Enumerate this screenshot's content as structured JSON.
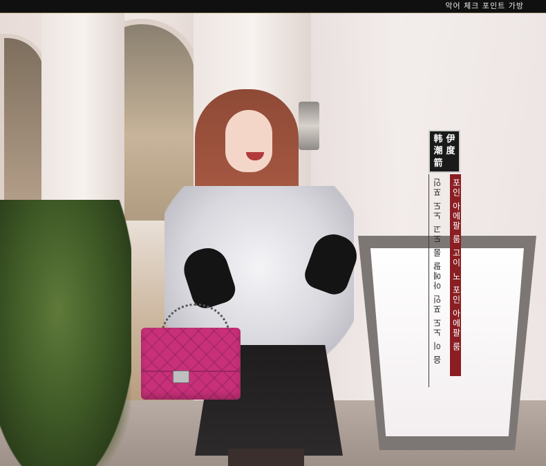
{
  "header": {
    "title": "악어 체크 포인트 가방"
  },
  "overlay": {
    "logo": {
      "chars": [
        "伊",
        "韩",
        "度",
        "潮",
        "箭"
      ]
    },
    "vertical_text_dark": "음 이 노도 포인 아에팔 룸 도고 노도 포인",
    "vertical_text_red": "포인 아에팔 룸 고이 노 포인 아에팔 룸"
  },
  "product": {
    "bag_color": "#c8307a"
  }
}
